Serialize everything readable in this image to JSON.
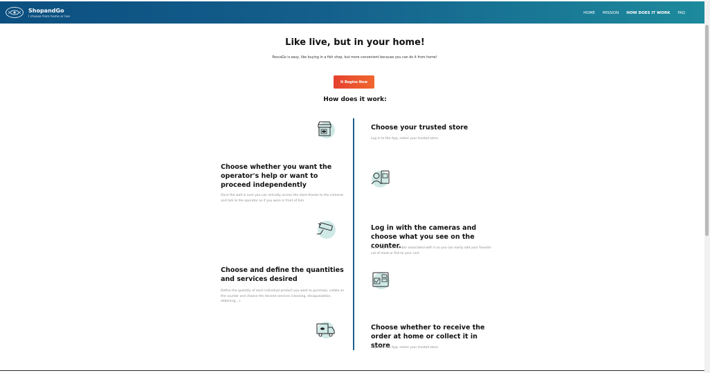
{
  "header": {
    "brand": "ShopandGo",
    "tagline": "I choose from home or live",
    "nav": [
      "HOME",
      "MISSION",
      "HOW DOES IT WORK",
      "FAQ"
    ]
  },
  "hero": {
    "title": "Like live, but in your home!",
    "text": "PescaGo is easy, like buying in a fish shop, but more convenient because you can do it from home!",
    "cta": "It Begins Now"
  },
  "how": {
    "title": "How does it work:",
    "steps": [
      {
        "title": "Choose your trusted store",
        "text": "Log in to the App, select your trusted store.",
        "icon": "store-icon"
      },
      {
        "title": "Choose whether you want the operator's help or want to proceed independently",
        "text": "Once the wait is over you can virtually access the store thanks to the cameras and talk to the operator as if you were in front of him.",
        "icon": "operator-icon"
      },
      {
        "title": "Log in with the cameras and choose what you see on the counter.",
        "text": "Each tag has a number associated with it so you can easily add your favorite cut of meat or fish to your cart.",
        "icon": "camera-icon"
      },
      {
        "title": "Choose and define the quantities and services desired",
        "text": "Define the quantity of each individual product you want to purchase, visible on the counter and choose the desired services (cleaning, decapunzation, deboning,...)",
        "icon": "quantities-icon"
      },
      {
        "title": "Choose whether to receive the order at home or collect it in store",
        "text": "Log in to the App, select your trusted store.",
        "icon": "delivery-truck-icon"
      }
    ]
  },
  "colors": {
    "header_start": "#0b4f80",
    "header_end": "#1d8a9c",
    "cta_start": "#e5412e",
    "cta_end": "#f0672e",
    "timeline": "#1b5f8c",
    "icon_bg": "#cfe9e6"
  }
}
